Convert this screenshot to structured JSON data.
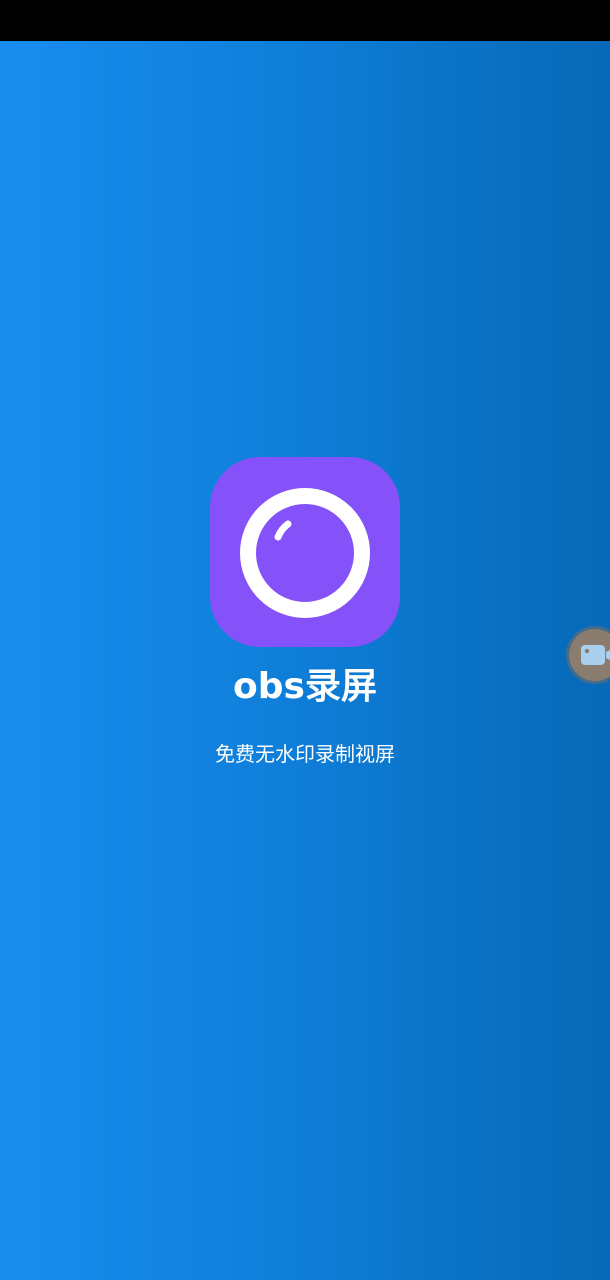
{
  "app": {
    "title": "obs录屏",
    "subtitle": "免费无水印录制视屏"
  },
  "icons": {
    "app_icon": "camera-lens-icon",
    "floating_button": "video-camera-icon"
  },
  "colors": {
    "status_bar": "#000000",
    "gradient_left": "#198DEF",
    "gradient_right": "#0769B7",
    "app_icon_bg": "#8452F8",
    "text": "#FFFFFF",
    "floating_button_bg": "#8A7C6F"
  }
}
